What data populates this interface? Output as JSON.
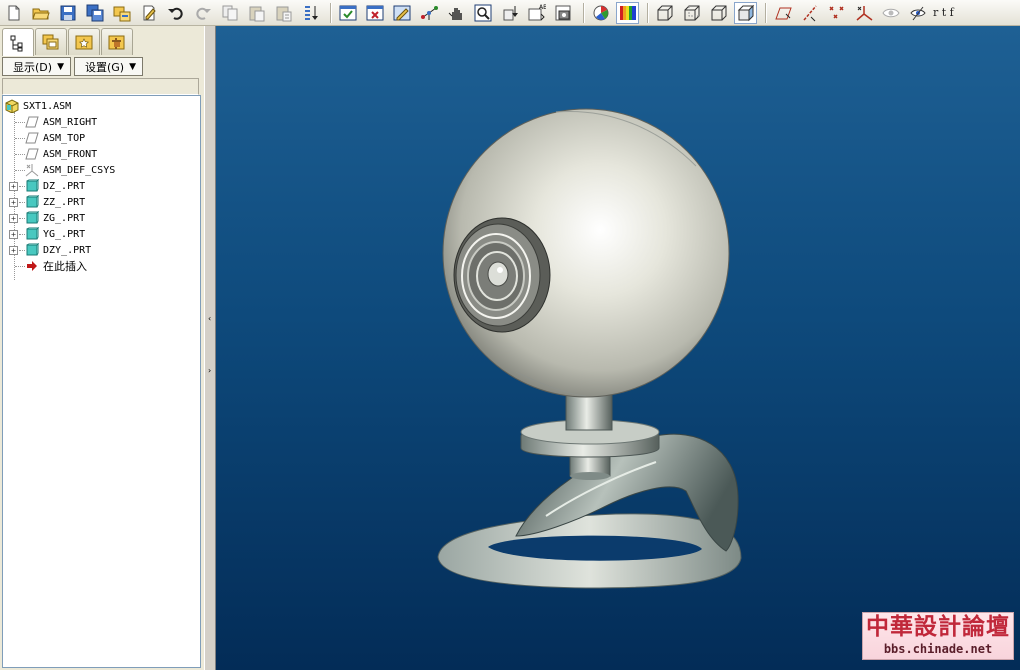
{
  "toolbar": {
    "icons": [
      "new-file-icon",
      "open-folder-icon",
      "save-icon",
      "save-copy-icon",
      "erase-icon",
      "regenerate-icon",
      "undo-icon",
      "redo-icon",
      "copy-icon",
      "paste-icon",
      "paste-special-icon",
      "reorder-icon",
      "window-activate-icon",
      "window-close-icon",
      "repaint-icon",
      "spin-center-icon",
      "pan-icon",
      "zoom-window-icon",
      "refit-icon",
      "saved-views-icon",
      "view-manager-icon",
      "appearance-icon",
      "color-palette-icon",
      "wireframe-icon",
      "hidden-line-icon",
      "no-hidden-icon",
      "shading-icon",
      "datum-plane-icon",
      "datum-axis-icon",
      "datum-point-icon",
      "coord-sys-icon",
      "eye-icon",
      "annotation-icon"
    ],
    "trailing_text": "r t f"
  },
  "left_panel": {
    "tabs": [
      "model-tree-tab",
      "folder-browser-tab",
      "favorites-tab",
      "connections-tab"
    ],
    "menus": {
      "display_label": "显示(D)",
      "settings_label": "设置(G)"
    },
    "tree": {
      "root": "SXT1.ASM",
      "datums": [
        "ASM_RIGHT",
        "ASM_TOP",
        "ASM_FRONT",
        "ASM_DEF_CSYS"
      ],
      "parts": [
        "DZ_.PRT",
        "ZZ_.PRT",
        "ZG_.PRT",
        "YG_.PRT",
        "DZY_.PRT"
      ],
      "insert_here": "在此插入"
    }
  },
  "colors": {
    "viewport_top": "#1e6094",
    "viewport_bottom": "#032c57",
    "model_surface": "#d8d8cc",
    "part_icon": "#48c8c0"
  },
  "watermark": {
    "title": "中華設計論壇",
    "url": "bbs.chinade.net"
  }
}
